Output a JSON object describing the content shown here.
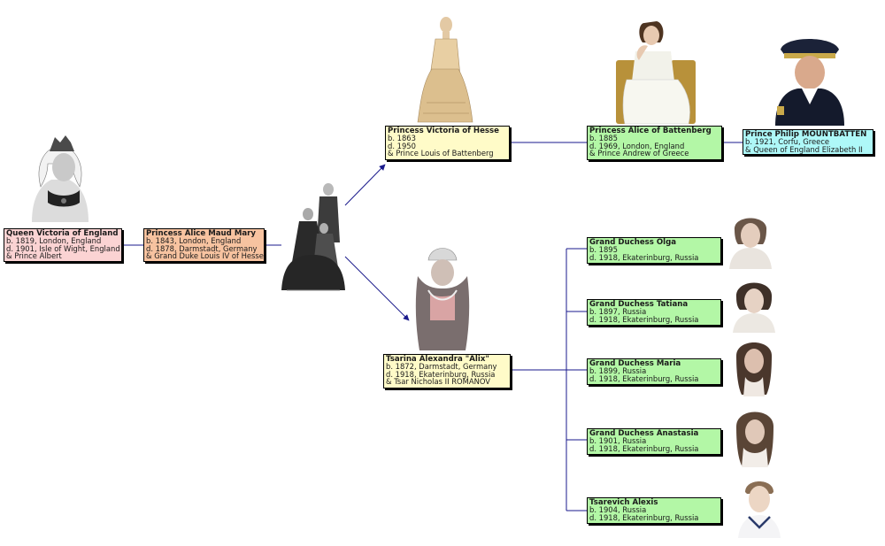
{
  "colors": {
    "pink": "#fbd3d3",
    "peach": "#f7c3a0",
    "yellow": "#fffbc8",
    "green": "#b3f7a6",
    "cyan": "#aef8f8",
    "line": "#1a1a8c"
  },
  "people": {
    "victoria": {
      "name": "Queen Victoria of England",
      "lines": [
        "b. 1819, London, England",
        "d. 1901, Isle of Wight, England",
        "& Prince Albert"
      ]
    },
    "alice": {
      "name": "Princess Alice Maud Mary",
      "lines": [
        "b. 1843, London, England",
        "d. 1878, Darmstadt, Germany",
        "& Grand Duke Louis IV of Hesse"
      ]
    },
    "victoria_hesse": {
      "name": "Princess Victoria of Hesse",
      "lines": [
        "b. 1863",
        "d. 1950",
        "& Prince Louis of Battenberg"
      ]
    },
    "alice_battenberg": {
      "name": "Princess Alice of Battenberg",
      "lines": [
        "b. 1885",
        "d. 1969, London, England",
        "& Prince Andrew of Greece"
      ]
    },
    "philip": {
      "name": "Prince Philip MOUNTBATTEN",
      "lines": [
        "b. 1921, Corfu, Greece",
        "& Queen of England Elizabeth II"
      ]
    },
    "alexandra": {
      "name": "Tsarina Alexandra \"Alix\"",
      "lines": [
        "b. 1872, Darmstadt, Germany",
        "d. 1918, Ekaterinburg, Russia",
        "& Tsar Nicholas II ROMANOV"
      ]
    },
    "olga": {
      "name": "Grand Duchess Olga",
      "lines": [
        "b. 1895",
        "d. 1918, Ekaterinburg, Russia"
      ]
    },
    "tatiana": {
      "name": "Grand Duchess Tatiana",
      "lines": [
        "b. 1897, Russia",
        "d. 1918, Ekaterinburg, Russia"
      ]
    },
    "maria": {
      "name": "Grand Duchess Maria",
      "lines": [
        "b. 1899, Russia",
        "d. 1918, Ekaterinburg, Russia"
      ]
    },
    "anastasia": {
      "name": "Grand Duchess Anastasia",
      "lines": [
        "b. 1901, Russia",
        "d. 1918, Ekaterinburg, Russia"
      ]
    },
    "alexis": {
      "name": "Tsarevich Alexis",
      "lines": [
        "b. 1904, Russia",
        "d. 1918, Ekaterinburg, Russia"
      ]
    }
  }
}
